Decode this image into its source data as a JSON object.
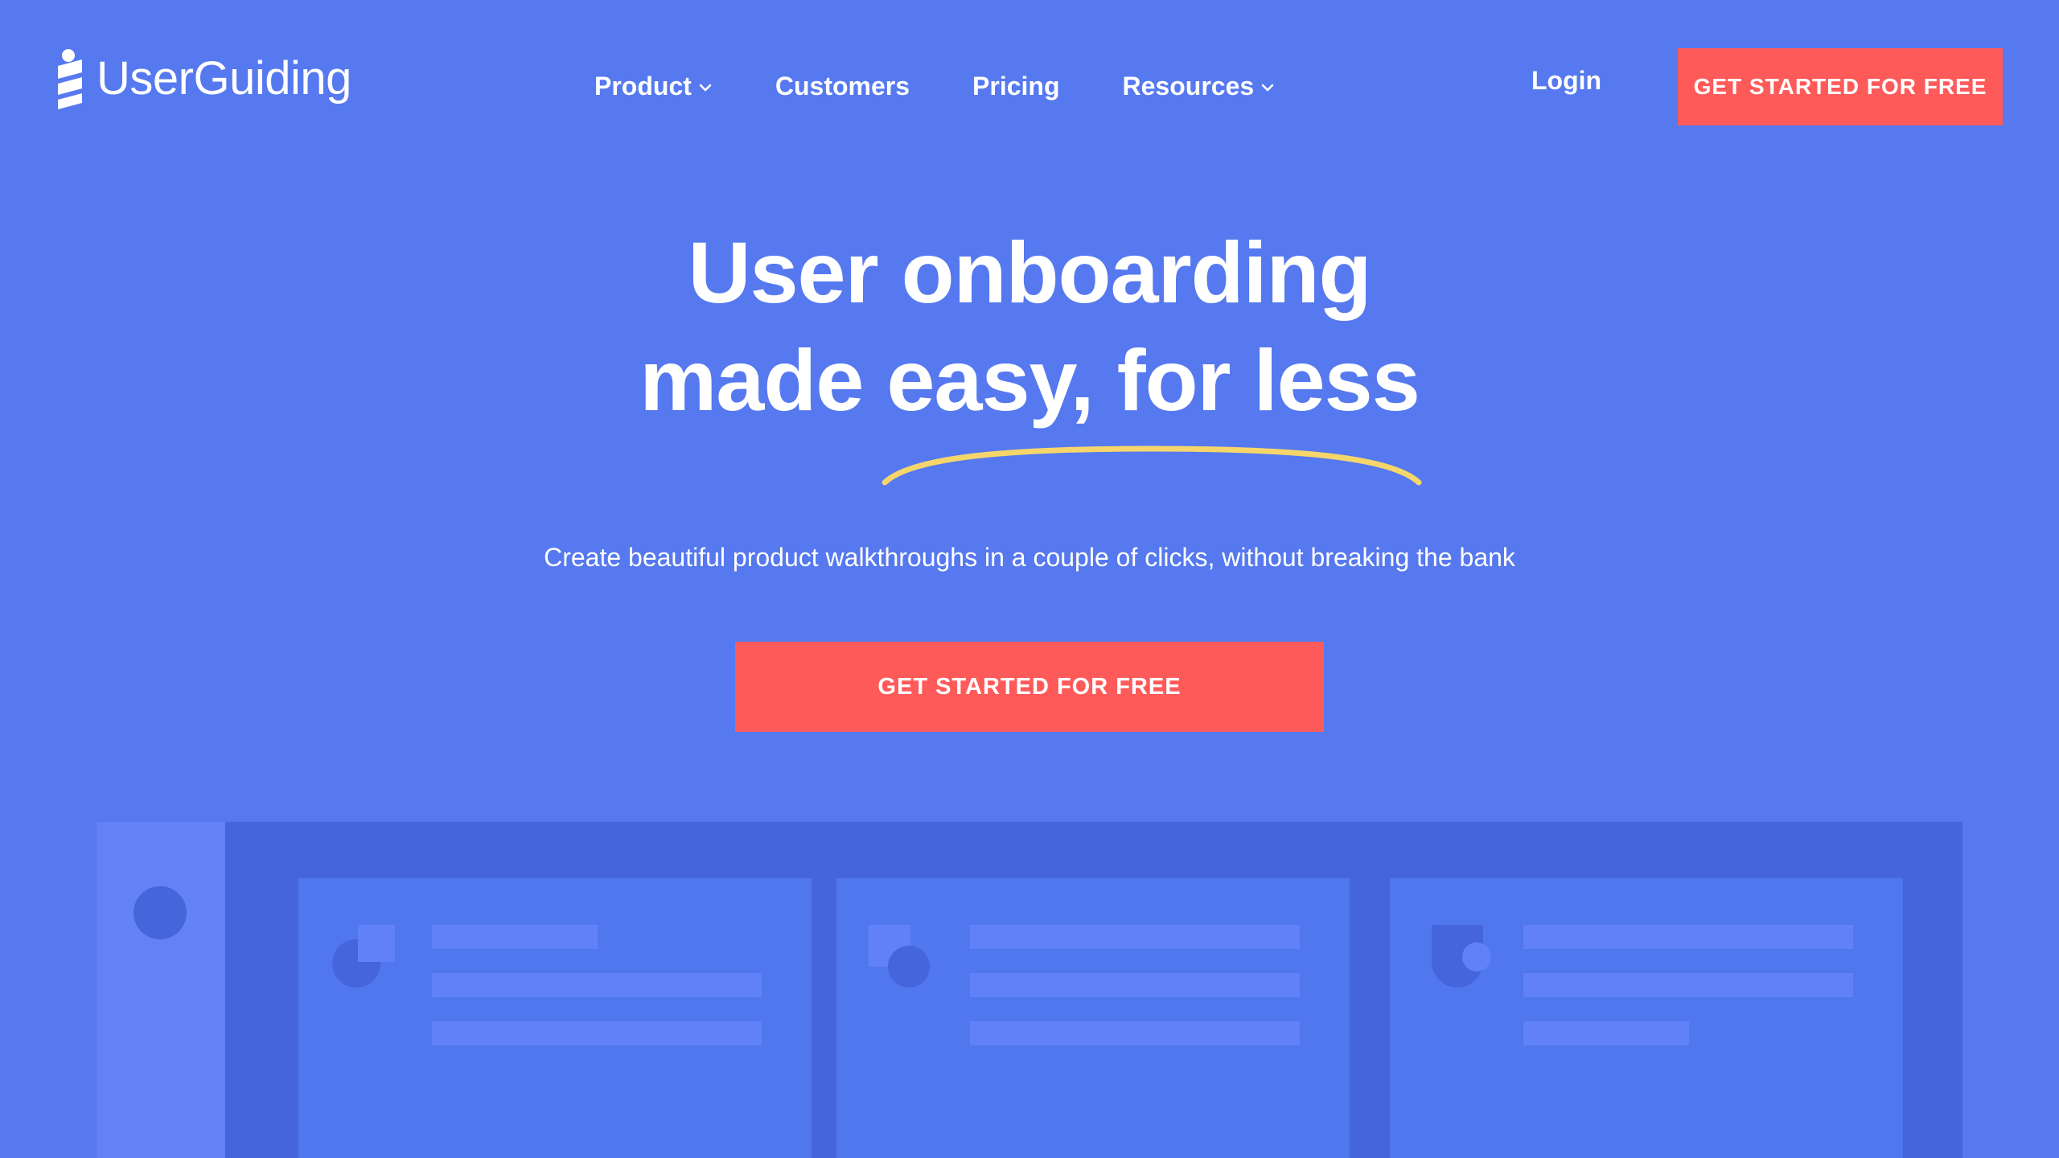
{
  "brand": {
    "name": "UserGuiding",
    "logo_icon": "userguiding-logo-icon"
  },
  "nav": {
    "items": [
      {
        "label": "Product",
        "has_dropdown": true
      },
      {
        "label": "Customers",
        "has_dropdown": false
      },
      {
        "label": "Pricing",
        "has_dropdown": false
      },
      {
        "label": "Resources",
        "has_dropdown": true
      }
    ],
    "login_label": "Login",
    "cta_label": "GET STARTED FOR FREE"
  },
  "hero": {
    "title_line1": "User onboarding",
    "title_line2": "made easy, for less",
    "subtitle": "Create beautiful product walkthroughs in a couple of clicks, without breaking the bank",
    "cta_label": "GET STARTED FOR FREE"
  },
  "colors": {
    "background": "#5679ef",
    "cta": "#ff5a5a",
    "underline": "#f6d66b",
    "mockup_frame": "#4565da",
    "mockup_sidebar": "#6382f5",
    "mockup_card": "#5077ee",
    "mockup_bar": "#6182f7"
  }
}
